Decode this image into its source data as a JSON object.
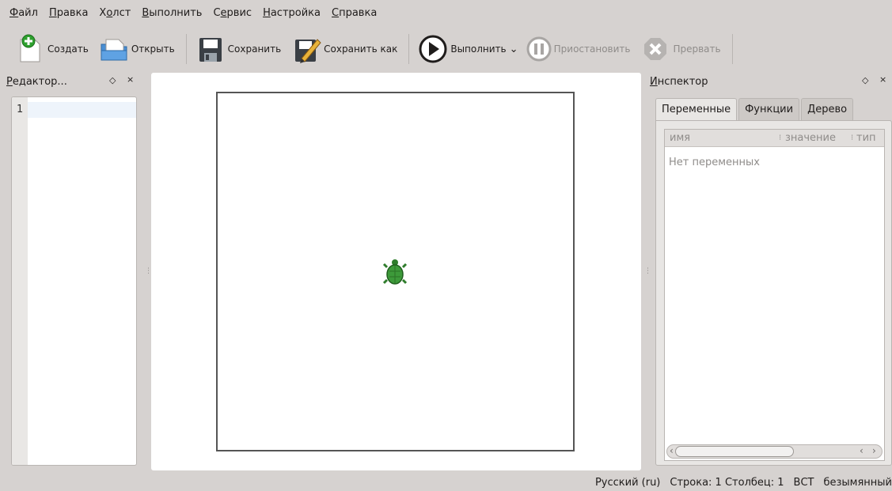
{
  "menubar": {
    "items": [
      {
        "accel": "Ф",
        "rest": "айл"
      },
      {
        "accel": "П",
        "rest": "равка"
      },
      {
        "pre": "Х",
        "accel": "о",
        "rest": "лст"
      },
      {
        "accel": "В",
        "rest": "ыполнить"
      },
      {
        "pre": "С",
        "accel": "е",
        "rest": "рвис"
      },
      {
        "accel": "Н",
        "rest": "астройка"
      },
      {
        "accel": "С",
        "rest": "правка"
      }
    ]
  },
  "toolbar": {
    "new_label": "Создать",
    "open_label": "Открыть",
    "save_label": "Сохранить",
    "save_as_label": "Сохранить как",
    "run_label": "Выполнить",
    "pause_label": "Приостановить",
    "abort_label": "Прервать"
  },
  "editor": {
    "title_accel": "Р",
    "title_rest": "едактор...",
    "line_number": "1"
  },
  "inspector": {
    "title_accel": "И",
    "title_rest": "нспектор",
    "tabs": [
      "Переменные",
      "Функции",
      "Дерево"
    ],
    "columns": [
      "имя",
      "значение",
      "тип"
    ],
    "empty_message": "Нет переменных"
  },
  "statusbar": {
    "language": "Русский (ru)",
    "position": "Строка: 1 Столбец: 1",
    "mode": "ВСТ",
    "filename": "безымянный"
  },
  "colors": {
    "window_bg": "#d6d2d0",
    "turtle_green": "#3d9a3a",
    "run_icon": "#1f1c1b"
  }
}
